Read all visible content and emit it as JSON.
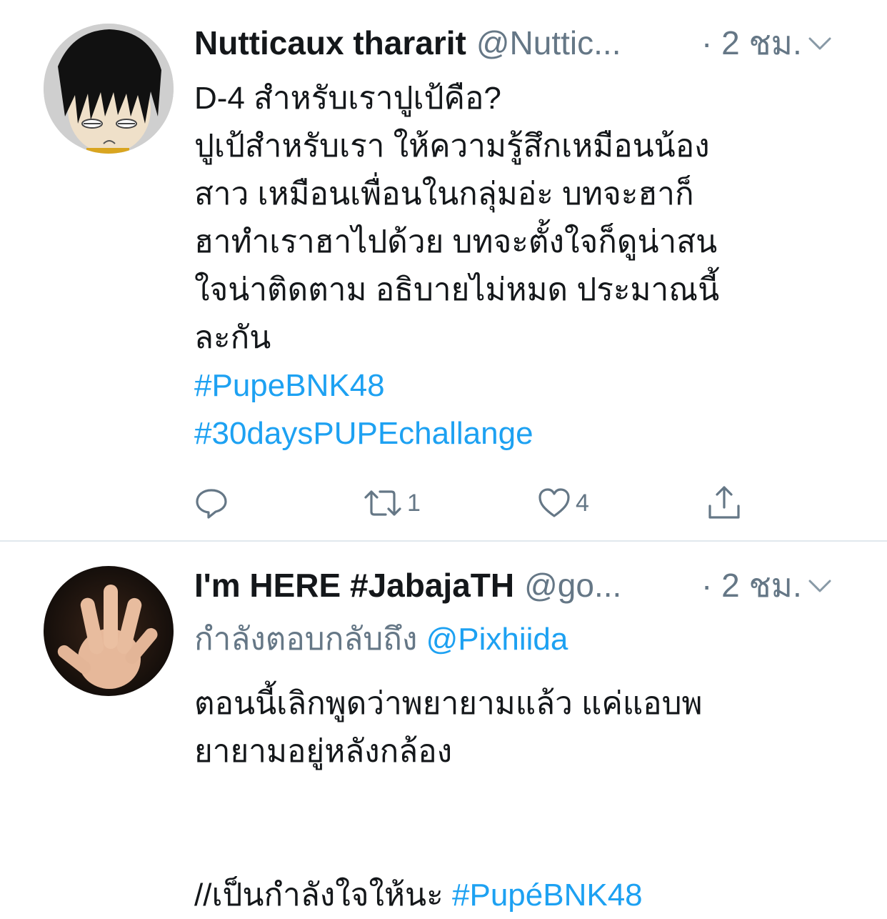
{
  "tweets": [
    {
      "author_name": "Nutticaux thararit",
      "handle": "@Nuttic...",
      "time": "· 2 ชม.",
      "lines": [
        "D-4 สำหรับเราปูเป้คือ?",
        "ปูเป้สำหรับเรา ให้ความรู้สึกเหมือนน้อง",
        "สาว เหมือนเพื่อนในกลุ่มอ่ะ บทจะฮาก็",
        "ฮาทำเราฮาไปด้วย บทจะตั้งใจก็ดูน่าสน",
        "ใจน่าติดตาม อธิบายไม่หมด ประมาณนี้",
        "ละกัน"
      ],
      "hashtags": [
        "#PupeBNK48",
        "#30daysPUPEchallange"
      ],
      "actions": {
        "reply_icon": "reply-icon",
        "retweet_icon": "retweet-icon",
        "retweet_count": "1",
        "like_icon": "heart-icon",
        "like_count": "4",
        "share_icon": "share-icon"
      }
    },
    {
      "author_name": "I'm HERE #JabajaTH",
      "handle": "@go...",
      "time": "· 2 ชม.",
      "replying_prefix": "กำลังตอบกลับถึง",
      "replying_mention": "@Pixhiida",
      "lines": [
        "ตอนนี้เลิกพูดว่าพยายามแล้ว แค่แอบพ",
        "ยายามอยู่หลังกล้อง"
      ],
      "last_line_prefix": "//เป็นกำลังใจให้นะ",
      "last_line_hashtag": "#PupéBNK48"
    }
  ],
  "colors": {
    "text": "#14171a",
    "secondary": "#657786",
    "link": "#1da1f2",
    "divider": "#e1e8ed"
  }
}
